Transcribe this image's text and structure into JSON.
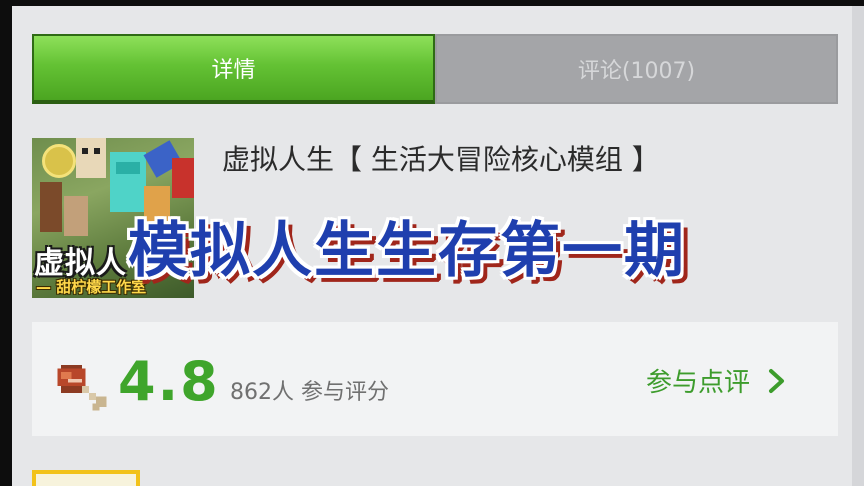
{
  "tabs": [
    {
      "label": "详情",
      "active": true
    },
    {
      "label": "评论(1007)",
      "active": false
    }
  ],
  "product": {
    "title": "虚拟人生【 生活大冒险核心模组 】",
    "thumbnail_title": "虚拟人",
    "thumbnail_subtitle": "— 甜柠檬工作室",
    "thumbnail_icon": "minecraft-characters-image"
  },
  "overlay_caption": "模拟人生生存第一期",
  "rating": {
    "icon": "meat-icon",
    "score": "4.8",
    "participants": "862人 参与评分",
    "cta_label": "参与点评",
    "cta_icon": "chevron-right-icon"
  },
  "colors": {
    "accent_green": "#3fa52b",
    "tab_inactive": "#a4a5a8",
    "caption_blue": "#1f3fae",
    "caption_red": "#a0261b"
  }
}
